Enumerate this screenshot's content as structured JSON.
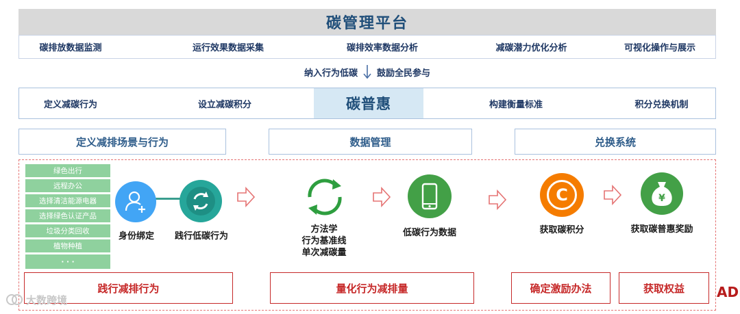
{
  "platform": {
    "title": "碳管理平台",
    "items": [
      "碳排放数据监测",
      "运行效果数据采集",
      "碳排效率数据分析",
      "减碳潜力优化分析",
      "可视化操作与展示"
    ]
  },
  "link": {
    "left": "纳入行为低碳",
    "right": "鼓励全民参与"
  },
  "puhui": {
    "center": "碳普惠",
    "items": [
      "定义减碳行为",
      "设立减碳积分",
      "构建衡量标准",
      "积分兑换机制"
    ]
  },
  "sections": [
    "定义减排场景与行为",
    "数据管理",
    "兑换系统"
  ],
  "behaviors": [
    "绿色出行",
    "远程办公",
    "选择清洁能源电器",
    "选择绿色认证产品",
    "垃圾分类回收",
    "植物种植",
    "· · ·"
  ],
  "nodes": {
    "identity": "身份绑定",
    "practice": "践行低碳行为",
    "method_lines": [
      "方法学",
      "行为基准线",
      "单次减碳量"
    ],
    "data": "低碳行为数据",
    "points": "获取碳积分",
    "reward": "获取碳普惠奖励",
    "points_symbol": "C",
    "reward_symbol": "¥"
  },
  "stages": [
    "践行减排行为",
    "量化行为减排量",
    "确定激励办法",
    "获取权益"
  ],
  "watermark": "大数跨境",
  "edge_text": "ADI",
  "colors": {
    "header_gray": "#d9d9d9",
    "navy": "#1f3864",
    "highlight": "#d6e8f4",
    "green_list": "#8fd19e",
    "identity_blue": "#42a5f5",
    "teal": "#26a69a",
    "green": "#43a047",
    "orange": "#f57c00",
    "red": "#c62828"
  }
}
